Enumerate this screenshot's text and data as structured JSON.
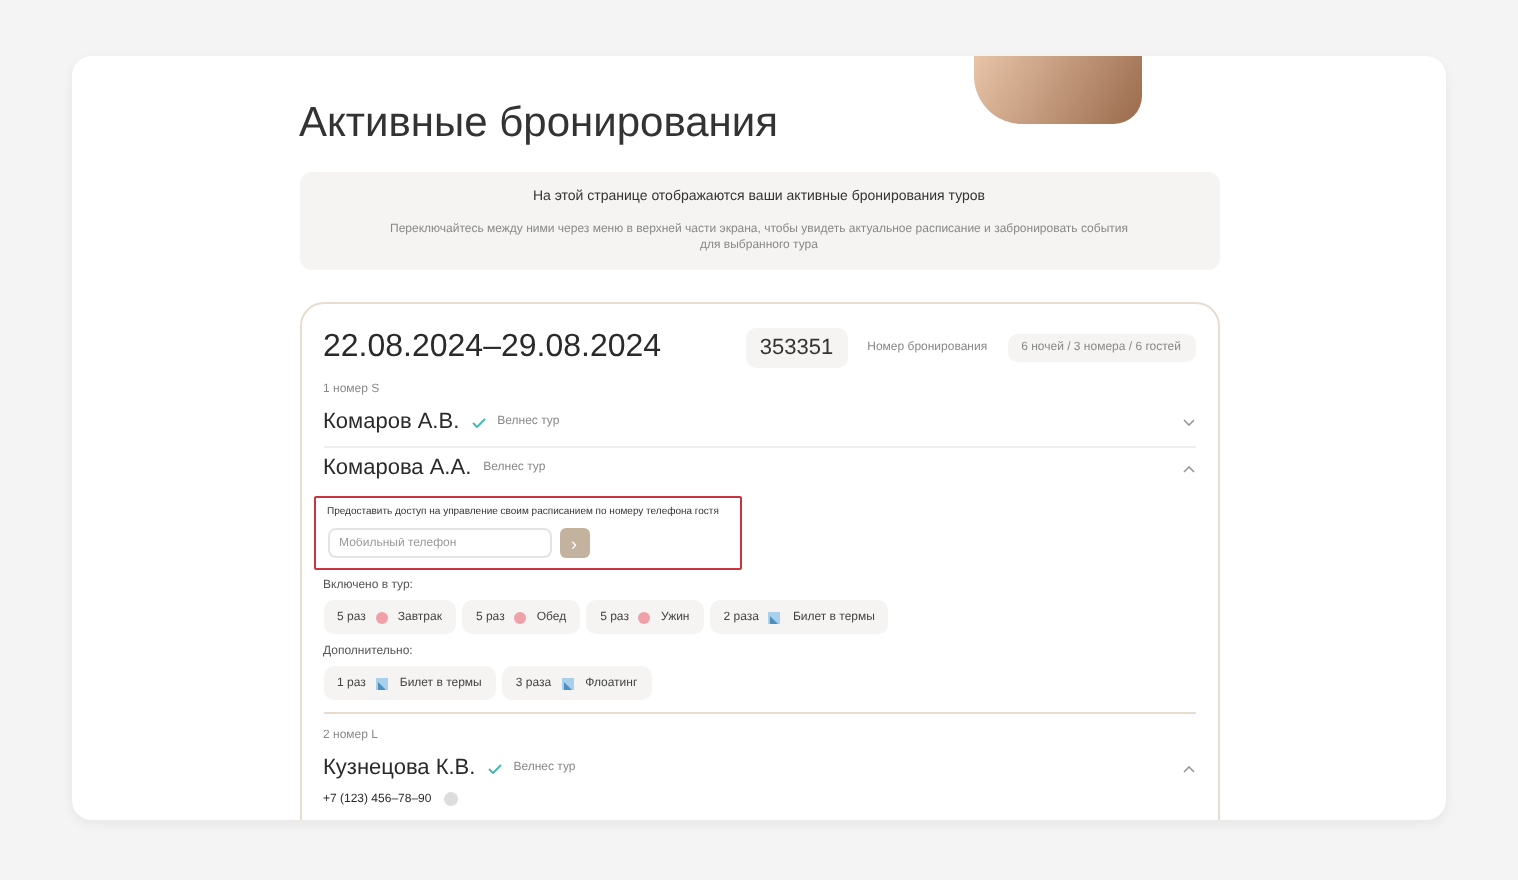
{
  "title": "Активные бронирования",
  "notice": {
    "heading": "На этой странице отображаются ваши активные бронирования туров",
    "text": "Переключайтесь между ними через меню в верхней части экрана, чтобы увидеть актуальное расписание и забронировать события для выбранного тура"
  },
  "booking": {
    "dates": "22.08.2024–29.08.2024",
    "number": "353351",
    "number_label": "Номер бронирования",
    "summary": "6 ночей / 3 номера / 6 гостей",
    "rooms": [
      {
        "label": "1 номер S",
        "guests": [
          {
            "name": "Комаров А.В.",
            "checked": true,
            "tour": "Велнес тур",
            "expanded": false
          },
          {
            "name": "Комарова А.А.",
            "checked": false,
            "tour": "Велнес тур",
            "expanded": true,
            "access": {
              "label": "Предоставить доступ на управление своим расписанием по номеру телефона гостя",
              "placeholder": "Мобильный телефон",
              "button": "›"
            },
            "included_label": "Включено в тур:",
            "included": [
              {
                "count": "5 раз",
                "kind": "food",
                "label": "Завтрак"
              },
              {
                "count": "5 раз",
                "kind": "food",
                "label": "Обед"
              },
              {
                "count": "5 раз",
                "kind": "food",
                "label": "Ужин"
              },
              {
                "count": "2 раза",
                "kind": "ticket",
                "label": "Билет в термы"
              }
            ],
            "extra_label": "Дополнительно:",
            "extra": [
              {
                "count": "1 раз",
                "kind": "ticket",
                "label": "Билет в термы"
              },
              {
                "count": "3 раза",
                "kind": "ticket",
                "label": "Флоатинг"
              }
            ]
          }
        ]
      },
      {
        "label": "2 номер L",
        "guests": [
          {
            "name": "Кузнецова К.В.",
            "checked": true,
            "tour": "Велнес тур",
            "expanded": true,
            "phone": "+7 (123) 456–78–90"
          }
        ]
      }
    ]
  }
}
